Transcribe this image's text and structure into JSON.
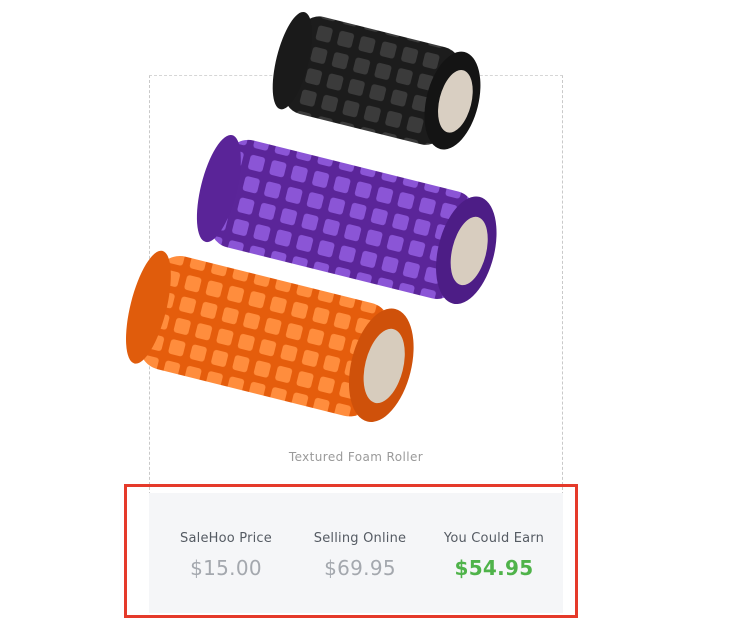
{
  "product": {
    "caption": "Textured Foam Roller",
    "rollers": [
      {
        "color_name": "black",
        "color": "#1e1e1e",
        "highlight": "#3a3a3a"
      },
      {
        "color_name": "purple",
        "color": "#6a2fb3",
        "highlight": "#8a52d4"
      },
      {
        "color_name": "orange",
        "color": "#f26a12",
        "highlight": "#ff8a3a"
      }
    ]
  },
  "pricing": {
    "salehoo_label": "SaleHoo Price",
    "salehoo_value": "$15.00",
    "online_label": "Selling Online",
    "online_value": "$69.95",
    "earn_label": "You Could Earn",
    "earn_value": "$54.95"
  },
  "colors": {
    "earn_green": "#4fb34a",
    "highlight_red": "#e53a2a"
  }
}
